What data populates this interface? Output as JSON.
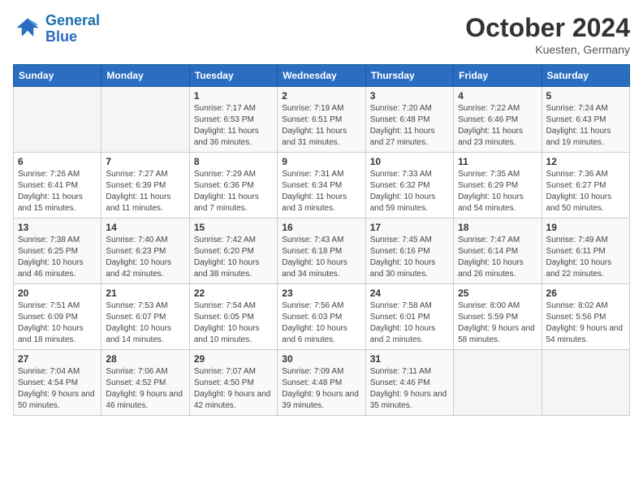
{
  "logo": {
    "text1": "General",
    "text2": "Blue"
  },
  "title": "October 2024",
  "location": "Kuesten, Germany",
  "days_header": [
    "Sunday",
    "Monday",
    "Tuesday",
    "Wednesday",
    "Thursday",
    "Friday",
    "Saturday"
  ],
  "weeks": [
    [
      {
        "day": "",
        "info": ""
      },
      {
        "day": "",
        "info": ""
      },
      {
        "day": "1",
        "info": "Sunrise: 7:17 AM\nSunset: 6:53 PM\nDaylight: 11 hours and 36 minutes."
      },
      {
        "day": "2",
        "info": "Sunrise: 7:19 AM\nSunset: 6:51 PM\nDaylight: 11 hours and 31 minutes."
      },
      {
        "day": "3",
        "info": "Sunrise: 7:20 AM\nSunset: 6:48 PM\nDaylight: 11 hours and 27 minutes."
      },
      {
        "day": "4",
        "info": "Sunrise: 7:22 AM\nSunset: 6:46 PM\nDaylight: 11 hours and 23 minutes."
      },
      {
        "day": "5",
        "info": "Sunrise: 7:24 AM\nSunset: 6:43 PM\nDaylight: 11 hours and 19 minutes."
      }
    ],
    [
      {
        "day": "6",
        "info": "Sunrise: 7:26 AM\nSunset: 6:41 PM\nDaylight: 11 hours and 15 minutes."
      },
      {
        "day": "7",
        "info": "Sunrise: 7:27 AM\nSunset: 6:39 PM\nDaylight: 11 hours and 11 minutes."
      },
      {
        "day": "8",
        "info": "Sunrise: 7:29 AM\nSunset: 6:36 PM\nDaylight: 11 hours and 7 minutes."
      },
      {
        "day": "9",
        "info": "Sunrise: 7:31 AM\nSunset: 6:34 PM\nDaylight: 11 hours and 3 minutes."
      },
      {
        "day": "10",
        "info": "Sunrise: 7:33 AM\nSunset: 6:32 PM\nDaylight: 10 hours and 59 minutes."
      },
      {
        "day": "11",
        "info": "Sunrise: 7:35 AM\nSunset: 6:29 PM\nDaylight: 10 hours and 54 minutes."
      },
      {
        "day": "12",
        "info": "Sunrise: 7:36 AM\nSunset: 6:27 PM\nDaylight: 10 hours and 50 minutes."
      }
    ],
    [
      {
        "day": "13",
        "info": "Sunrise: 7:38 AM\nSunset: 6:25 PM\nDaylight: 10 hours and 46 minutes."
      },
      {
        "day": "14",
        "info": "Sunrise: 7:40 AM\nSunset: 6:23 PM\nDaylight: 10 hours and 42 minutes."
      },
      {
        "day": "15",
        "info": "Sunrise: 7:42 AM\nSunset: 6:20 PM\nDaylight: 10 hours and 38 minutes."
      },
      {
        "day": "16",
        "info": "Sunrise: 7:43 AM\nSunset: 6:18 PM\nDaylight: 10 hours and 34 minutes."
      },
      {
        "day": "17",
        "info": "Sunrise: 7:45 AM\nSunset: 6:16 PM\nDaylight: 10 hours and 30 minutes."
      },
      {
        "day": "18",
        "info": "Sunrise: 7:47 AM\nSunset: 6:14 PM\nDaylight: 10 hours and 26 minutes."
      },
      {
        "day": "19",
        "info": "Sunrise: 7:49 AM\nSunset: 6:11 PM\nDaylight: 10 hours and 22 minutes."
      }
    ],
    [
      {
        "day": "20",
        "info": "Sunrise: 7:51 AM\nSunset: 6:09 PM\nDaylight: 10 hours and 18 minutes."
      },
      {
        "day": "21",
        "info": "Sunrise: 7:53 AM\nSunset: 6:07 PM\nDaylight: 10 hours and 14 minutes."
      },
      {
        "day": "22",
        "info": "Sunrise: 7:54 AM\nSunset: 6:05 PM\nDaylight: 10 hours and 10 minutes."
      },
      {
        "day": "23",
        "info": "Sunrise: 7:56 AM\nSunset: 6:03 PM\nDaylight: 10 hours and 6 minutes."
      },
      {
        "day": "24",
        "info": "Sunrise: 7:58 AM\nSunset: 6:01 PM\nDaylight: 10 hours and 2 minutes."
      },
      {
        "day": "25",
        "info": "Sunrise: 8:00 AM\nSunset: 5:59 PM\nDaylight: 9 hours and 58 minutes."
      },
      {
        "day": "26",
        "info": "Sunrise: 8:02 AM\nSunset: 5:56 PM\nDaylight: 9 hours and 54 minutes."
      }
    ],
    [
      {
        "day": "27",
        "info": "Sunrise: 7:04 AM\nSunset: 4:54 PM\nDaylight: 9 hours and 50 minutes."
      },
      {
        "day": "28",
        "info": "Sunrise: 7:06 AM\nSunset: 4:52 PM\nDaylight: 9 hours and 46 minutes."
      },
      {
        "day": "29",
        "info": "Sunrise: 7:07 AM\nSunset: 4:50 PM\nDaylight: 9 hours and 42 minutes."
      },
      {
        "day": "30",
        "info": "Sunrise: 7:09 AM\nSunset: 4:48 PM\nDaylight: 9 hours and 39 minutes."
      },
      {
        "day": "31",
        "info": "Sunrise: 7:11 AM\nSunset: 4:46 PM\nDaylight: 9 hours and 35 minutes."
      },
      {
        "day": "",
        "info": ""
      },
      {
        "day": "",
        "info": ""
      }
    ]
  ]
}
